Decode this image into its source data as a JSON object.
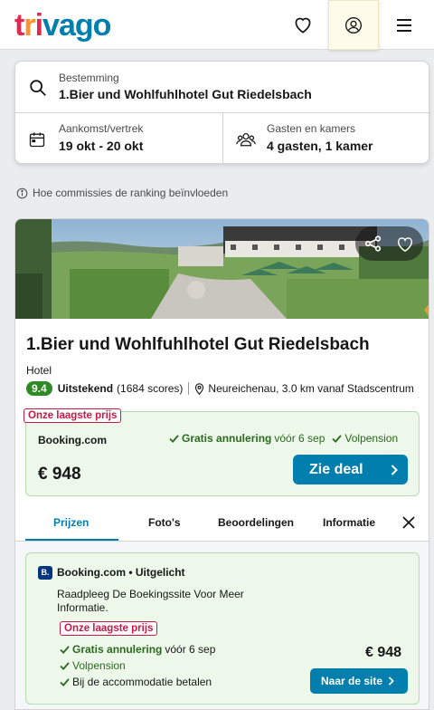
{
  "header": {
    "logo_letters": [
      "t",
      "r",
      "i",
      "v",
      "a",
      "g",
      "o"
    ],
    "icons": {
      "favorites": "heart-icon",
      "account": "user-circle-icon",
      "menu": "hamburger-menu-icon"
    }
  },
  "search": {
    "destination_label": "Bestemming",
    "destination_value": "1.Bier und Wohlfuhlhotel Gut Riedelsbach",
    "dates_label": "Aankomst/vertrek",
    "dates_value": "19 okt - 20 okt",
    "guests_label": "Gasten en kamers",
    "guests_value": "4 gasten, 1 kamer",
    "icons": {
      "destination": "search-icon",
      "dates": "calendar-icon",
      "guests": "people-icon"
    }
  },
  "commission_text": "Hoe commissies de ranking beïnvloeden",
  "hotel": {
    "name": "1.Bier und Wohlfuhlhotel Gut Riedelsbach",
    "type": "Hotel",
    "score": "9.4",
    "rating_word": "Uitstekend",
    "rating_count": "(1684 scores)",
    "location": "Neureichenau, 3.0 km vanaf Stadscentrum",
    "deal": {
      "badge": "Onze laagste prijs",
      "site": "Booking.com",
      "cancellation": "Gratis annulering",
      "cancellation_date": "vóór 6 sep",
      "board": "Volpension",
      "price": "€ 948",
      "button": "Zie deal"
    }
  },
  "tabs": [
    "Prijzen",
    "Foto's",
    "Beoordelingen",
    "Informatie"
  ],
  "offer": {
    "logo": "B.",
    "title": "Booking.com • Uitgelicht",
    "description": "Raadpleeg De Boekingssite Voor Meer Informatie.",
    "badge": "Onze laagste prijs",
    "cancellation": "Gratis annulering",
    "cancellation_date": "vóór 6 sep",
    "board": "Volpension",
    "payment": "Bij de accommodatie betalen",
    "price": "€ 948",
    "button": "Naar de site"
  },
  "colors": {
    "brand_blue": "#007faf",
    "score_green": "#2e8b23",
    "badge_red": "#c41a46",
    "deal_bg": "#edf7ea"
  }
}
